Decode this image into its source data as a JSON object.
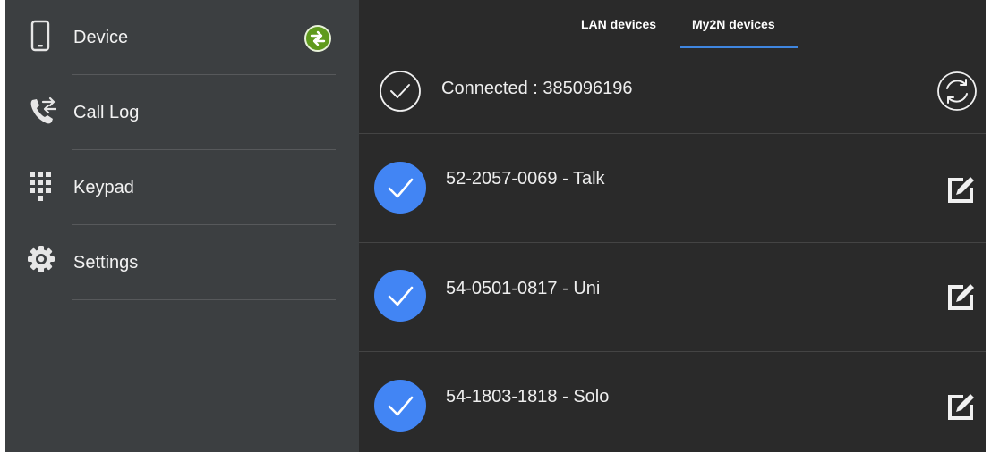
{
  "colors": {
    "sidebar_bg": "#3c3f41",
    "content_bg": "#2a2a2a",
    "accent_blue": "#4285f4",
    "sync_green": "#5f9a1d"
  },
  "sidebar": {
    "items": [
      {
        "label": "Device",
        "icon": "phone-device-icon"
      },
      {
        "label": "Call Log",
        "icon": "call-log-icon"
      },
      {
        "label": "Keypad",
        "icon": "keypad-icon"
      },
      {
        "label": "Settings",
        "icon": "gear-icon"
      }
    ]
  },
  "tabs": [
    {
      "label": "LAN devices",
      "active": false
    },
    {
      "label": "My2N devices",
      "active": true
    }
  ],
  "status": {
    "text": "Connected : 385096196"
  },
  "devices": [
    {
      "label": "52-2057-0069 - Talk",
      "checked": true
    },
    {
      "label": "54-0501-0817 - Uni",
      "checked": true
    },
    {
      "label": "54-1803-1818 - Solo",
      "checked": true
    }
  ]
}
